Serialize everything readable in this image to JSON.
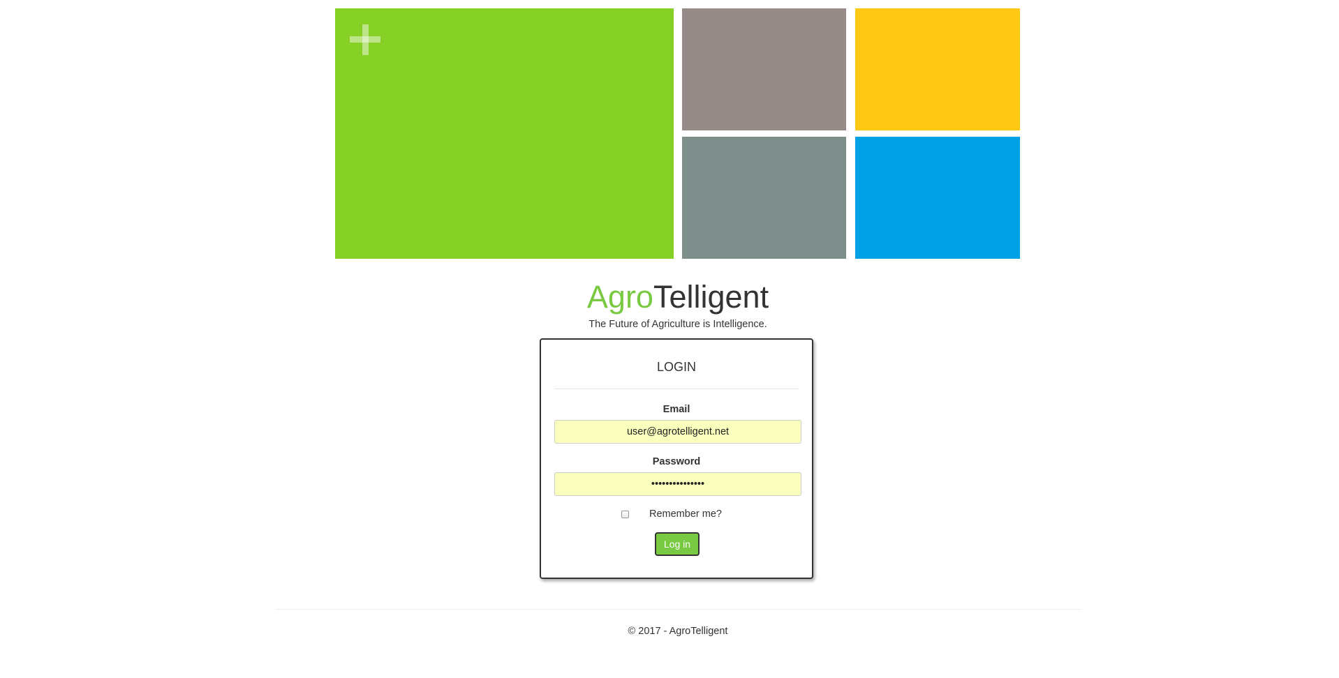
{
  "brand": {
    "part1": "Agro",
    "part2": "Telligent",
    "tagline": "The Future of Agriculture is Intelligence."
  },
  "tiles": {
    "colors": [
      "#87d026",
      "#968b88",
      "#fdc713",
      "#7d8e8b",
      "#00a2e5"
    ],
    "icon": "plus-icon"
  },
  "login": {
    "title": "LOGIN",
    "email_label": "Email",
    "email_value": "user@agrotelligent.net",
    "password_label": "Password",
    "password_value": "•••••••••••••••",
    "remember_label": "Remember me?",
    "remember_checked": false,
    "submit_label": "Log in"
  },
  "footer": {
    "text": "© 2017 - AgroTelligent"
  },
  "colors": {
    "accent": "#7ac943",
    "input_autofill": "#faffbd"
  }
}
